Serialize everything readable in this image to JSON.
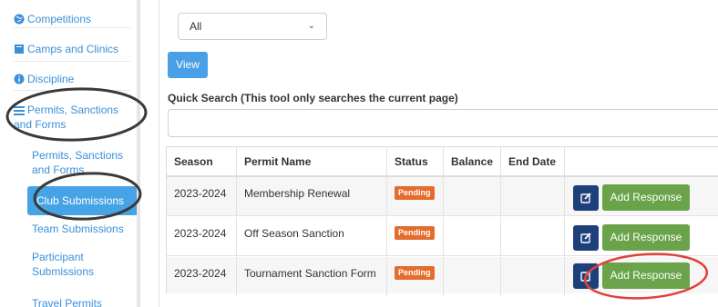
{
  "sidebar": {
    "items": [
      {
        "label": "Competitions",
        "icon": "globe-icon"
      },
      {
        "label": "Camps and Clinics",
        "icon": "book-icon"
      },
      {
        "label": "Discipline",
        "icon": "info-circle-icon"
      },
      {
        "label": "Permits, Sanctions and Forms",
        "icon": "list-icon"
      }
    ],
    "sub_items": [
      {
        "label": "Permits, Sanctions and Forms"
      },
      {
        "label": "Club Submissions"
      },
      {
        "label": "Team Submissions"
      },
      {
        "label": "Participant Submissions"
      },
      {
        "label": "Travel Permits"
      }
    ]
  },
  "filter": {
    "selected": "All"
  },
  "view_button": "View",
  "quick_search": {
    "label": "Quick Search (This tool only searches the current page)",
    "value": ""
  },
  "table": {
    "headers": [
      "Season",
      "Permit Name",
      "Status",
      "Balance",
      "End Date",
      ""
    ],
    "rows": [
      {
        "season": "2023-2024",
        "permit": "Membership Renewal",
        "status": "Pending",
        "balance": "",
        "end_date": "",
        "action": "Add Response"
      },
      {
        "season": "2023-2024",
        "permit": "Off Season Sanction",
        "status": "Pending",
        "balance": "",
        "end_date": "",
        "action": "Add Response"
      },
      {
        "season": "2023-2024",
        "permit": "Tournament Sanction Form",
        "status": "Pending",
        "balance": "",
        "end_date": "",
        "action": "Add Response"
      }
    ]
  },
  "colors": {
    "link": "#3a8fd9",
    "active": "#46a4e6",
    "pending": "#e46c2c",
    "add_response": "#6aa34a",
    "edit": "#1d3f7a",
    "annotation_dark": "#3a3a3a",
    "annotation_red": "#e0413a"
  }
}
